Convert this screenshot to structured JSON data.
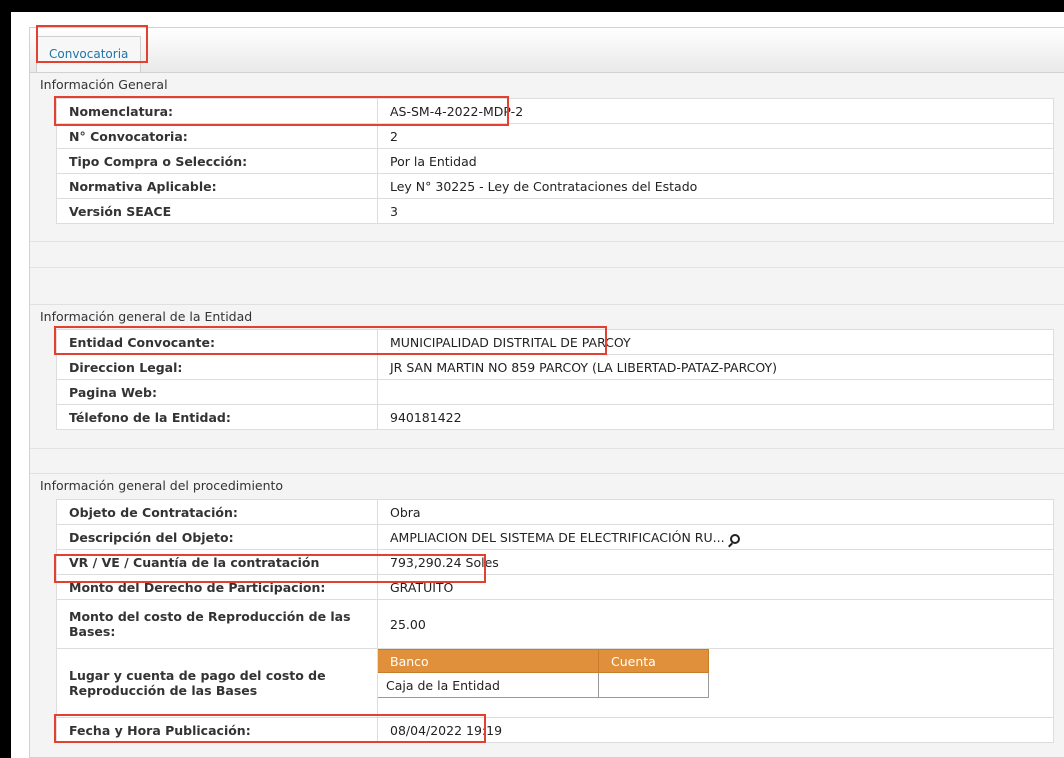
{
  "tab": {
    "label": "Convocatoria"
  },
  "sections": {
    "general": {
      "title": "Información General",
      "rows": [
        {
          "label": "Nomenclatura:",
          "value": "AS-SM-4-2022-MDP-2"
        },
        {
          "label": "N° Convocatoria:",
          "value": "2"
        },
        {
          "label": "Tipo Compra o Selección:",
          "value": "Por la Entidad"
        },
        {
          "label": "Normativa Aplicable:",
          "value": "Ley N° 30225 - Ley de Contrataciones del Estado"
        },
        {
          "label": "Versión SEACE",
          "value": "3"
        }
      ]
    },
    "entidad": {
      "title": "Información general de la Entidad",
      "rows": [
        {
          "label": "Entidad Convocante:",
          "value": "MUNICIPALIDAD DISTRITAL DE PARCOY"
        },
        {
          "label": "Direccion Legal:",
          "value": "JR SAN MARTIN NO 859 PARCOY (LA LIBERTAD-PATAZ-PARCOY)"
        },
        {
          "label": "Pagina Web:",
          "value": ""
        },
        {
          "label": "Télefono de la Entidad:",
          "value": "940181422"
        }
      ]
    },
    "procedimiento": {
      "title": "Información general del procedimiento",
      "rows": [
        {
          "label": "Objeto de Contratación:",
          "value": "Obra"
        },
        {
          "label": "Descripción del Objeto:",
          "value": "AMPLIACION DEL SISTEMA DE ELECTRIFICACIÓN RU...",
          "icon": "magnifier-icon"
        },
        {
          "label": "VR / VE / Cuantía de la contratación",
          "value": "793,290.24 Soles"
        },
        {
          "label": "Monto del Derecho de Participacion:",
          "value": "GRATUITO"
        },
        {
          "label": "Monto del costo de Reproducción de las Bases:",
          "value": "25.00"
        },
        {
          "label": "Lugar y cuenta de pago del costo de Reproducción de las Bases",
          "bank_table": {
            "headers": [
              "Banco",
              "Cuenta"
            ],
            "rows": [
              [
                "Caja de la Entidad",
                ""
              ]
            ]
          }
        },
        {
          "label": "Fecha y Hora Publicación:",
          "value": "08/04/2022 19:19"
        }
      ]
    }
  },
  "colors": {
    "highlight": "#e4402f",
    "tab_text": "#1f74a8",
    "bank_header": "#e0903a"
  }
}
